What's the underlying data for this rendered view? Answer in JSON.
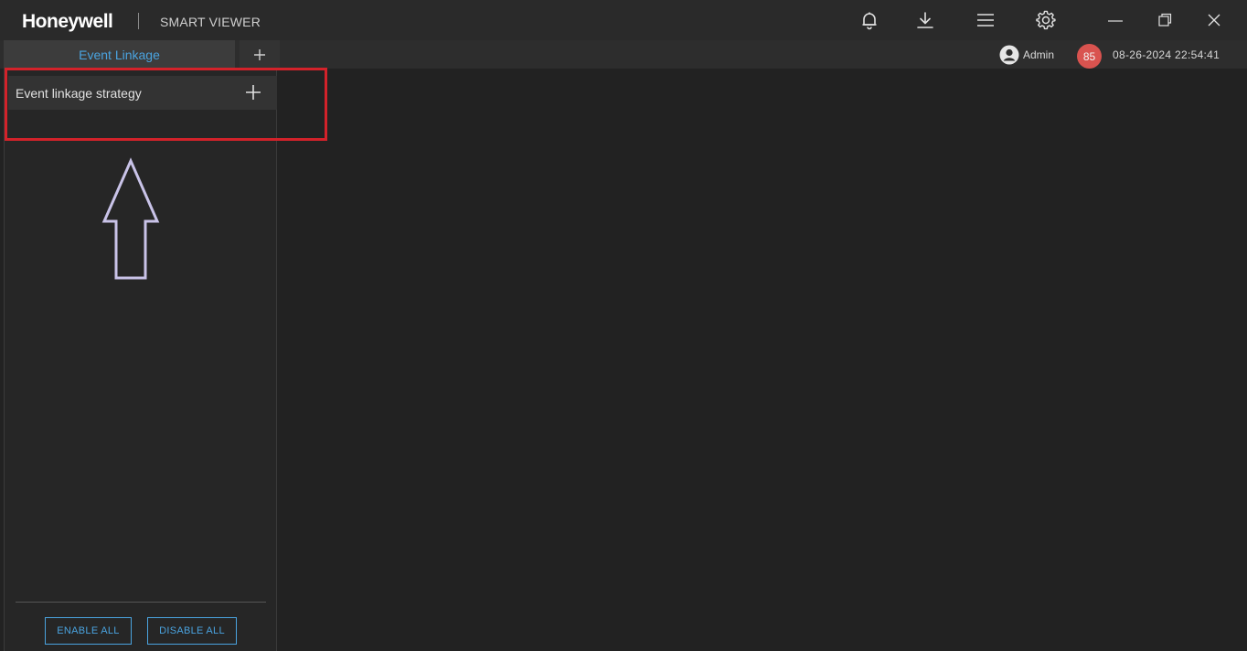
{
  "titlebar": {
    "brand": "Honeywell",
    "product": "SMART VIEWER",
    "icons": [
      "bell-icon",
      "download-icon",
      "menu-icon",
      "gear-icon",
      "minimize-icon",
      "restore-icon",
      "close-icon"
    ]
  },
  "tabs": [
    {
      "label": "Event Linkage",
      "active": true
    }
  ],
  "status": {
    "user": "Admin",
    "notification_count": "85",
    "datetime": "08-26-2024 22:54:41"
  },
  "panel": {
    "title": "Event linkage strategy",
    "enable_all": "ENABLE ALL",
    "disable_all": "DISABLE ALL"
  },
  "colors": {
    "accent": "#4aa3df",
    "background": "#222222",
    "badge": "#d9534f",
    "annotation_box": "#d3222a",
    "annotation_arrow": "#c9c3e8"
  }
}
